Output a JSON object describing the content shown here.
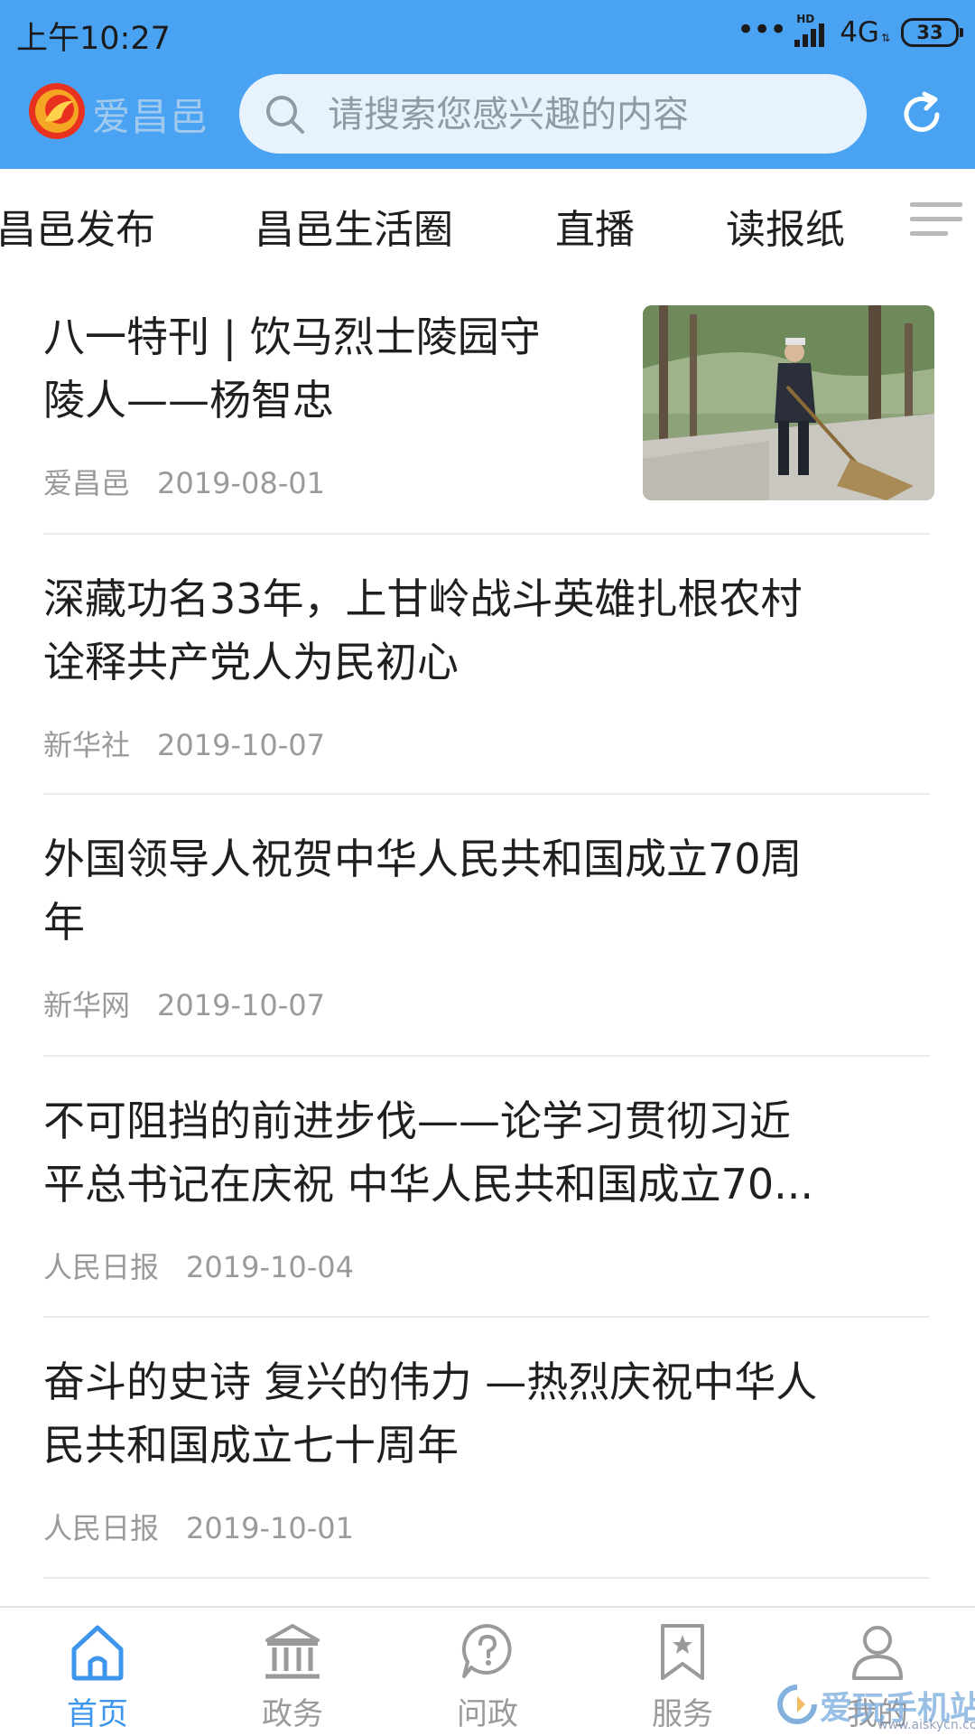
{
  "status_bar": {
    "time": "上午10:27",
    "dots": "•••",
    "hd": "HD",
    "network": "4G",
    "battery": "33"
  },
  "header": {
    "brand": "爱昌邑",
    "search_placeholder": "请搜索您感兴趣的内容",
    "accent_color": "#4aa3f2"
  },
  "tabs": [
    {
      "label": "昌邑发布"
    },
    {
      "label": "昌邑生活圈"
    },
    {
      "label": "直播"
    },
    {
      "label": "读报纸"
    }
  ],
  "news": [
    {
      "title_lines": [
        "八一特刊 | 饮马烈士陵园守",
        "陵人——杨智忠"
      ],
      "source": "爱昌邑",
      "date": "2019-08-01",
      "has_thumb": true
    },
    {
      "title_lines": [
        "深藏功名33年，上甘岭战斗英雄扎根农村",
        "诠释共产党人为民初心"
      ],
      "source": "新华社",
      "date": "2019-10-07"
    },
    {
      "title_lines": [
        "外国领导人祝贺中华人民共和国成立70周",
        "年"
      ],
      "source": "新华网",
      "date": "2019-10-07"
    },
    {
      "title_lines": [
        "不可阻挡的前进步伐——论学习贯彻习近",
        "平总书记在庆祝 中华人民共和国成立70..."
      ],
      "source": "人民日报",
      "date": "2019-10-04"
    },
    {
      "title_lines": [
        "奋斗的史诗 复兴的伟力 —热烈庆祝中华人",
        "民共和国成立七十周年"
      ],
      "source": "人民日报",
      "date": "2019-10-01"
    }
  ],
  "bottom_nav": [
    {
      "label": "首页",
      "icon": "home-icon",
      "active": true
    },
    {
      "label": "政务",
      "icon": "government-building-icon"
    },
    {
      "label": "问政",
      "icon": "question-bubble-icon"
    },
    {
      "label": "服务",
      "icon": "bookmark-star-icon"
    },
    {
      "label": "我的",
      "icon": "user-icon"
    }
  ],
  "watermark": {
    "text": "爱玩手机站",
    "url": "www.aiskycn.com"
  }
}
